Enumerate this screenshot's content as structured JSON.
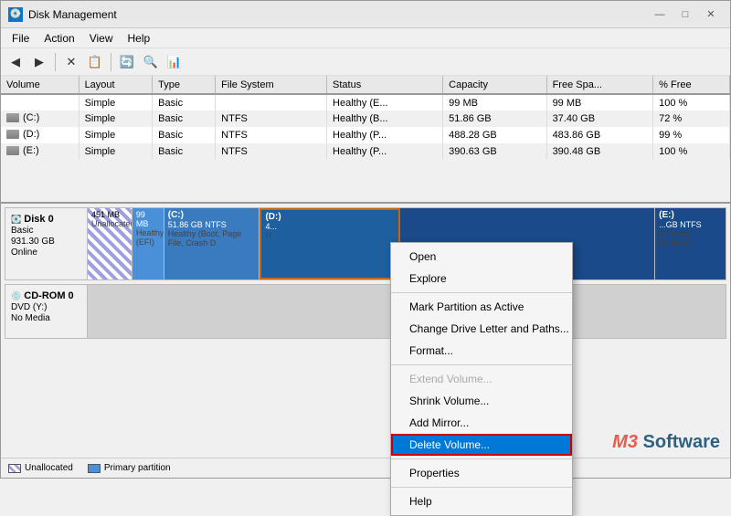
{
  "window": {
    "title": "Disk Management",
    "icon": "💿",
    "controls": {
      "minimize": "—",
      "maximize": "□",
      "close": "✕"
    }
  },
  "menubar": {
    "items": [
      "File",
      "Action",
      "View",
      "Help"
    ]
  },
  "toolbar": {
    "buttons": [
      "←",
      "→",
      "✕",
      "📋",
      "🔄",
      "🔍",
      "📊"
    ]
  },
  "table": {
    "headers": [
      "Volume",
      "Layout",
      "Type",
      "File System",
      "Status",
      "Capacity",
      "Free Spa...",
      "% Free"
    ],
    "rows": [
      {
        "volume": "",
        "layout": "Simple",
        "type": "Basic",
        "fs": "",
        "status": "Healthy (E...",
        "capacity": "99 MB",
        "free": "99 MB",
        "pct": "100 %"
      },
      {
        "volume": "(C:)",
        "layout": "Simple",
        "type": "Basic",
        "fs": "NTFS",
        "status": "Healthy (B...",
        "capacity": "51.86 GB",
        "free": "37.40 GB",
        "pct": "72 %"
      },
      {
        "volume": "(D:)",
        "layout": "Simple",
        "type": "Basic",
        "fs": "NTFS",
        "status": "Healthy (P...",
        "capacity": "488.28 GB",
        "free": "483.86 GB",
        "pct": "99 %"
      },
      {
        "volume": "(E:)",
        "layout": "Simple",
        "type": "Basic",
        "fs": "NTFS",
        "status": "Healthy (P...",
        "capacity": "390.63 GB",
        "free": "390.48 GB",
        "pct": "100 %"
      }
    ]
  },
  "disks": [
    {
      "name": "Disk 0",
      "type": "Basic",
      "size": "931.30 GB",
      "status": "Online",
      "partitions": [
        {
          "label": "",
          "size": "451 MB",
          "desc": "Unallocated",
          "style": "unalloc",
          "width": "8%"
        },
        {
          "label": "",
          "size": "99 MB",
          "desc": "Healthy (EFI)",
          "style": "blue-light",
          "width": "6%"
        },
        {
          "label": "(C:)",
          "size": "51.86 GB NTFS",
          "desc": "Healthy (Boot, Page File, Crash D",
          "style": "blue-mid",
          "width": "14%"
        },
        {
          "label": "(D:)",
          "size": "4...",
          "desc": "H",
          "style": "blue-selected",
          "width": "22%"
        },
        {
          "label": "",
          "size": "",
          "desc": "",
          "style": "blue-dark",
          "width": "40%"
        },
        {
          "label": "(E:)",
          "size": "...GB NTFS",
          "desc": "(Primary Partition)",
          "style": "blue-dark",
          "width": "10%"
        }
      ]
    }
  ],
  "cdrom": {
    "name": "CD-ROM 0",
    "type": "DVD (Y:)",
    "status": "No Media"
  },
  "context_menu": {
    "items": [
      {
        "label": "Open",
        "disabled": false,
        "type": "item"
      },
      {
        "label": "Explore",
        "disabled": false,
        "type": "item"
      },
      {
        "label": "",
        "type": "sep"
      },
      {
        "label": "Mark Partition as Active",
        "disabled": false,
        "type": "item"
      },
      {
        "label": "Change Drive Letter and Paths...",
        "disabled": false,
        "type": "item"
      },
      {
        "label": "Format...",
        "disabled": false,
        "type": "item"
      },
      {
        "label": "",
        "type": "sep"
      },
      {
        "label": "Extend Volume...",
        "disabled": true,
        "type": "item"
      },
      {
        "label": "Shrink Volume...",
        "disabled": false,
        "type": "item"
      },
      {
        "label": "Add Mirror...",
        "disabled": false,
        "type": "item"
      },
      {
        "label": "Delete Volume...",
        "disabled": false,
        "type": "item",
        "highlighted": true
      },
      {
        "label": "",
        "type": "sep"
      },
      {
        "label": "Properties",
        "disabled": false,
        "type": "item"
      },
      {
        "label": "",
        "type": "sep"
      },
      {
        "label": "Help",
        "disabled": false,
        "type": "item"
      }
    ]
  },
  "legend": {
    "items": [
      {
        "style": "unalloc",
        "label": "Unallocated"
      },
      {
        "style": "primary",
        "label": "Primary partition"
      }
    ]
  },
  "watermark": {
    "prefix": "M3",
    "suffix": " Software"
  }
}
